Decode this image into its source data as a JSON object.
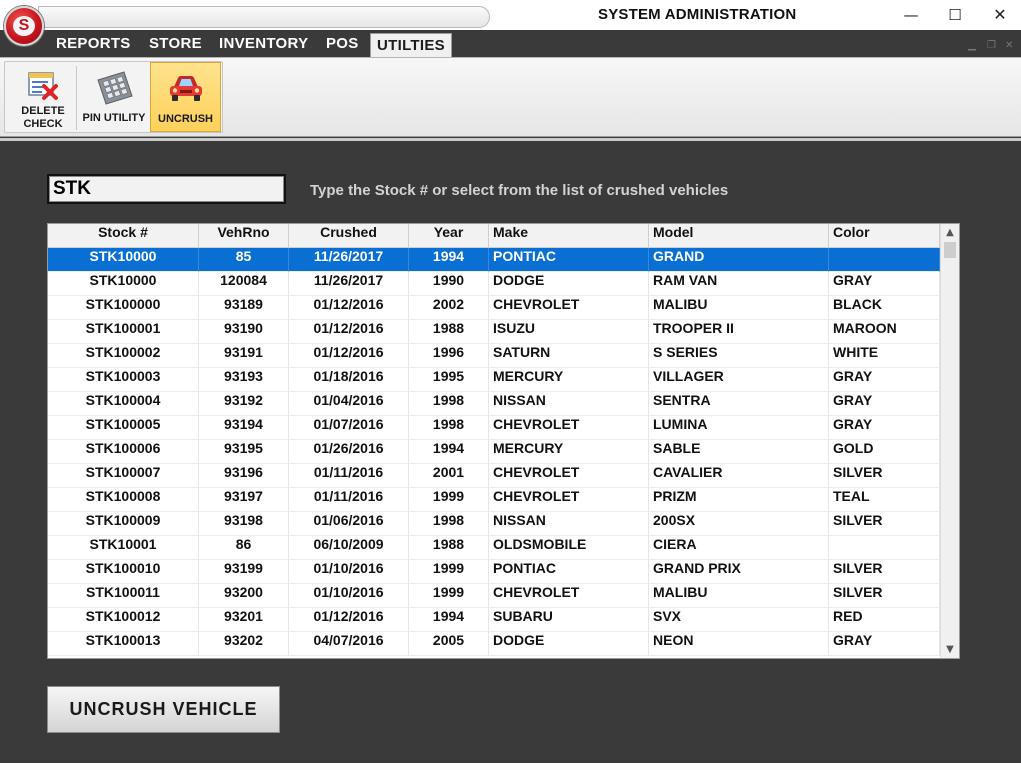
{
  "window": {
    "title": "SYSTEM ADMINISTRATION",
    "logo_letter": "S",
    "controls": {
      "minimize": "—",
      "maximize": "☐",
      "close": "✕"
    }
  },
  "menu": {
    "items": [
      {
        "label": "REPORTS"
      },
      {
        "label": "STORE"
      },
      {
        "label": "INVENTORY"
      },
      {
        "label": "POS"
      },
      {
        "label": "UTILTIES"
      }
    ],
    "active": "UTILTIES"
  },
  "ribbon": {
    "buttons": [
      {
        "label_line1": "DELETE",
        "label_line2": "CHECK",
        "icon": "delete-check-icon"
      },
      {
        "label": "PIN UTILITY",
        "icon": "keypad-icon"
      },
      {
        "label": "UNCRUSH",
        "icon": "car-icon",
        "selected": true
      }
    ]
  },
  "search": {
    "value": "STK",
    "instruction": "Type the Stock # or select from the list of crushed vehicles"
  },
  "grid": {
    "columns": [
      "Stock #",
      "VehRno",
      "Crushed",
      "Year",
      "Make",
      "Model",
      "Color"
    ],
    "selected_row": 0,
    "rows": [
      [
        "STK10000",
        "85",
        "11/26/2017",
        "1994",
        "PONTIAC",
        "GRAND",
        ""
      ],
      [
        "STK10000",
        "120084",
        "11/26/2017",
        "1990",
        "DODGE",
        "RAM VAN",
        "GRAY"
      ],
      [
        "STK100000",
        "93189",
        "01/12/2016",
        "2002",
        "CHEVROLET",
        "MALIBU",
        "BLACK"
      ],
      [
        "STK100001",
        "93190",
        "01/12/2016",
        "1988",
        "ISUZU",
        "TROOPER II",
        "MAROON"
      ],
      [
        "STK100002",
        "93191",
        "01/12/2016",
        "1996",
        "SATURN",
        "S SERIES",
        "WHITE"
      ],
      [
        "STK100003",
        "93193",
        "01/18/2016",
        "1995",
        "MERCURY",
        "VILLAGER",
        "GRAY"
      ],
      [
        "STK100004",
        "93192",
        "01/04/2016",
        "1998",
        "NISSAN",
        "SENTRA",
        "GRAY"
      ],
      [
        "STK100005",
        "93194",
        "01/07/2016",
        "1998",
        "CHEVROLET",
        "LUMINA",
        "GRAY"
      ],
      [
        "STK100006",
        "93195",
        "01/26/2016",
        "1994",
        "MERCURY",
        "SABLE",
        "GOLD"
      ],
      [
        "STK100007",
        "93196",
        "01/11/2016",
        "2001",
        "CHEVROLET",
        "CAVALIER",
        "SILVER"
      ],
      [
        "STK100008",
        "93197",
        "01/11/2016",
        "1999",
        "CHEVROLET",
        "PRIZM",
        "TEAL"
      ],
      [
        "STK100009",
        "93198",
        "01/06/2016",
        "1998",
        "NISSAN",
        "200SX",
        "SILVER"
      ],
      [
        "STK10001",
        "86",
        "06/10/2009",
        "1988",
        "OLDSMOBILE",
        "CIERA",
        ""
      ],
      [
        "STK100010",
        "93199",
        "01/10/2016",
        "1999",
        "PONTIAC",
        "GRAND PRIX",
        "SILVER"
      ],
      [
        "STK100011",
        "93200",
        "01/10/2016",
        "1999",
        "CHEVROLET",
        "MALIBU",
        "SILVER"
      ],
      [
        "STK100012",
        "93201",
        "01/12/2016",
        "1994",
        "SUBARU",
        "SVX",
        "RED"
      ],
      [
        "STK100013",
        "93202",
        "04/07/2016",
        "2005",
        "DODGE",
        "NEON",
        "GRAY"
      ]
    ]
  },
  "actions": {
    "uncrush_label": "UNCRUSH VEHICLE"
  },
  "colors": {
    "selection": "#0a6fd3",
    "background": "#3a3a3a",
    "ribbon_highlight": "#fdd15a"
  }
}
